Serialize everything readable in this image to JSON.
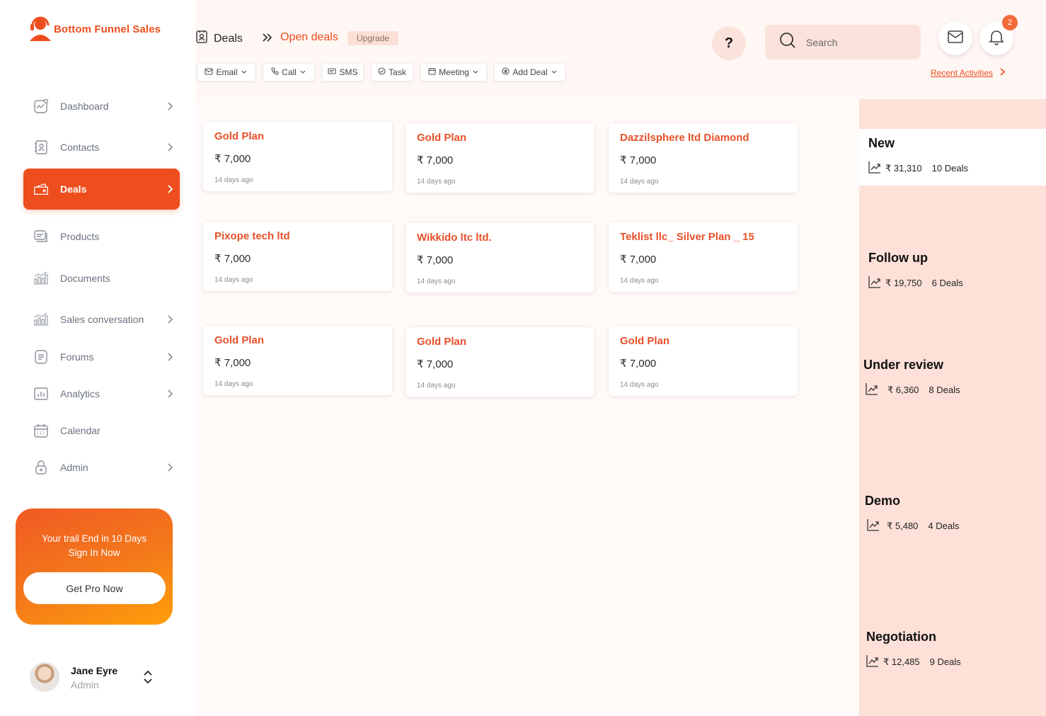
{
  "app": {
    "brand": "Bottom Funnel Sales"
  },
  "sidebar": {
    "items": [
      {
        "label": "Dashboard",
        "icon": "dashboard-icon",
        "has_chevron": true
      },
      {
        "label": "Contacts",
        "icon": "contacts-icon",
        "has_chevron": true
      },
      {
        "label": "Deals",
        "icon": "deals-icon",
        "has_chevron": true,
        "active": true
      },
      {
        "label": "Products",
        "icon": "products-icon",
        "has_chevron": false
      },
      {
        "label": "Documents",
        "icon": "documents-icon",
        "has_chevron": false
      },
      {
        "label": "Sales conversation",
        "icon": "sales-conversation-icon",
        "has_chevron": true
      },
      {
        "label": "Forums",
        "icon": "forums-icon",
        "has_chevron": true
      },
      {
        "label": "Analytics",
        "icon": "analytics-icon",
        "has_chevron": true
      },
      {
        "label": "Calendar",
        "icon": "calendar-icon",
        "has_chevron": false
      },
      {
        "label": "Admin",
        "icon": "lock-icon",
        "has_chevron": true
      }
    ],
    "promo": {
      "line1": "Your trail End in 10 Days",
      "line2": "Sign In Now",
      "button": "Get Pro Now"
    },
    "user": {
      "name": "Jane Eyre",
      "role": "Admin"
    }
  },
  "header": {
    "breadcrumb_root": "Deals",
    "breadcrumb_current": "Open deals",
    "upgrade_label": "Upgrade",
    "help_label": "?",
    "search_placeholder": "Search",
    "notification_count": "2",
    "recent_activities": "Recent Activities"
  },
  "actions": [
    {
      "label": "Email",
      "icon": "mail-icon",
      "dropdown": true
    },
    {
      "label": "Call",
      "icon": "phone-icon",
      "dropdown": true
    },
    {
      "label": "SMS",
      "icon": "sms-icon",
      "dropdown": false
    },
    {
      "label": "Task",
      "icon": "check-circle-icon",
      "dropdown": false
    },
    {
      "label": "Meeting",
      "icon": "calendar-icon",
      "dropdown": true
    },
    {
      "label": "Add Deal",
      "icon": "add-deal-icon",
      "dropdown": true
    }
  ],
  "deals": [
    {
      "title": "Gold Plan",
      "amount": "₹ 7,000",
      "age": "14 days ago"
    },
    {
      "title": "Gold Plan",
      "amount": "₹ 7,000",
      "age": "14 days ago"
    },
    {
      "title": "Dazzilsphere ltd Diamond",
      "amount": "₹ 7,000",
      "age": "14 days ago"
    },
    {
      "title": "Pixope tech ltd",
      "amount": "₹ 7,000",
      "age": "14 days ago"
    },
    {
      "title": "Wikkido ltc ltd.",
      "amount": "₹ 7,000",
      "age": "14 days ago"
    },
    {
      "title": "Teklist llc_ Silver Plan _ 15",
      "amount": "₹ 7,000",
      "age": "14 days ago"
    },
    {
      "title": "Gold Plan",
      "amount": "₹ 7,000",
      "age": "14 days ago"
    },
    {
      "title": "Gold Plan",
      "amount": "₹ 7,000",
      "age": "14 days ago"
    },
    {
      "title": "Gold Plan",
      "amount": "₹ 7,000",
      "age": "14 days ago"
    }
  ],
  "stages": [
    {
      "name": "New",
      "amount": "₹ 31,310",
      "count": "10 Deals"
    },
    {
      "name": "Follow up",
      "amount": "₹ 19,750",
      "count": "6 Deals"
    },
    {
      "name": "Under review",
      "amount": "₹ 6,360",
      "count": "8 Deals"
    },
    {
      "name": "Demo",
      "amount": "₹ 5,480",
      "count": "4 Deals"
    },
    {
      "name": "Negotiation",
      "amount": "₹ 12,485",
      "count": "9 Deals"
    }
  ],
  "colors": {
    "accent": "#ee4e1e",
    "stage_panel": "#fde1d8",
    "main_bg": "#fff9f7"
  }
}
